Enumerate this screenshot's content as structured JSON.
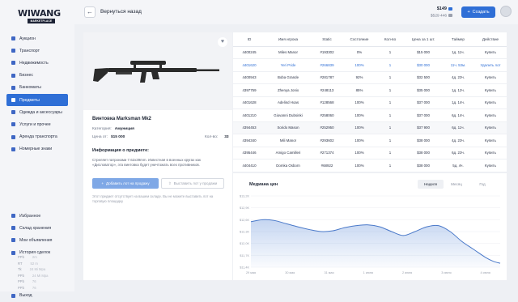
{
  "logo": {
    "main": "WIWANG",
    "sub": "MARKETPLACE"
  },
  "sidebar": {
    "items": [
      {
        "label": "Аукцион",
        "icon": "gavel-icon"
      },
      {
        "label": "Транспорт",
        "icon": "car-icon"
      },
      {
        "label": "Недвижимость",
        "icon": "house-icon"
      },
      {
        "label": "Бизнес",
        "icon": "briefcase-icon"
      },
      {
        "label": "Банкоматы",
        "icon": "atm-icon"
      },
      {
        "label": "Предметы",
        "icon": "box-icon",
        "active": true
      },
      {
        "label": "Одежда и аксессуары",
        "icon": "shirt-icon"
      },
      {
        "label": "Услуги и прочее",
        "icon": "tools-icon"
      },
      {
        "label": "Аренда транспорта",
        "icon": "key-icon"
      },
      {
        "label": "Номерные знаки",
        "icon": "plate-icon"
      }
    ],
    "bottom": [
      {
        "label": "Избранное",
        "icon": "heart-icon"
      },
      {
        "label": "Склад хранения",
        "icon": "warehouse-icon"
      },
      {
        "label": "Мои объявления",
        "icon": "list-icon"
      },
      {
        "label": "История сделок",
        "icon": "history-icon"
      },
      {
        "label": "Выход",
        "icon": "exit-icon"
      }
    ],
    "history": [
      {
        "a": "PPb",
        "b": "2m"
      },
      {
        "a": "RT",
        "b": "52 m"
      },
      {
        "a": "Tk",
        "b": "24 Mi Mpa"
      },
      {
        "a": "PPb",
        "b": "24 Mi Mpa"
      },
      {
        "a": "PPb",
        "b": "76"
      },
      {
        "a": "PPb",
        "b": "76"
      }
    ]
  },
  "topbar": {
    "back_label": "Вернуться назад",
    "balance_main": "$149",
    "balance_sub": "$529 446",
    "create_label": "Создать"
  },
  "item": {
    "title": "Винтовка Marksman Mk2",
    "category_label": "Категория:",
    "category": "Амуниция",
    "price_label": "Цена от:",
    "price": "$15 000",
    "qty_label": "Кол-во:",
    "qty": "33",
    "info_title": "Информация о предмете:",
    "info_text": "Стреляет патронами 7.62x39mm. Известная в военных кругах как «Дисловатор», эта винтовка будет уничтожать всех противников.",
    "btn_add": "Добавить лот на продажу",
    "btn_sell": "Выставить лот у продажи",
    "note": "Этот предмет отсутствует на вашем складе. Вы не можете выставить лот на торговую площадку"
  },
  "table": {
    "headers": [
      "ID",
      "Имя игрока",
      "Static",
      "Состояние",
      "Кол-во",
      "Цена за 1 шт.",
      "Таймер",
      "Действие"
    ],
    "rows": [
      [
        "4400245",
        "Miles Manor",
        "#193302",
        "0%",
        "1",
        "$15 000",
        "1д. 11ч.",
        "Купить"
      ],
      [
        "4401620",
        "Yeri Pride",
        "#266839",
        "100%",
        "1",
        "$30 000",
        "11ч. 53м.",
        "Удалить лот"
      ],
      [
        "4400943",
        "Boba Grande",
        "#281787",
        "92%",
        "1",
        "$32 500",
        "4д. 23ч.",
        "Купить"
      ],
      [
        "4397759",
        "Zhenya Jonix",
        "#248113",
        "85%",
        "1",
        "$35 000",
        "1д. 12ч.",
        "Купить"
      ],
      [
        "4401628",
        "Adelind Hoas",
        "#128568",
        "100%",
        "1",
        "$37 000",
        "1д. 14ч.",
        "Купить"
      ],
      [
        "4401210",
        "Giovanni Dubsinki",
        "#258060",
        "100%",
        "1",
        "$37 000",
        "6д. 14ч.",
        "Купить"
      ],
      [
        "4394453",
        "Sorido Mason",
        "#252950",
        "100%",
        "1",
        "$37 900",
        "6д. 11ч.",
        "Купить"
      ],
      [
        "4394340",
        "Mili Manor",
        "#293602",
        "100%",
        "1",
        "$38 000",
        "4д. 23ч.",
        "Купить"
      ],
      [
        "4395446",
        "Amigo Camilleri",
        "#271374",
        "100%",
        "1",
        "$38 000",
        "6д. 23ч.",
        "Купить"
      ],
      [
        "4404410",
        "Domka Osborn",
        "#68922",
        "100%",
        "1",
        "$38 000",
        "5д. 4ч.",
        "Купить"
      ]
    ]
  },
  "chart": {
    "title": "Медиана цен",
    "tabs": [
      "Неделя",
      "Месяц",
      "Год"
    ],
    "active_tab": "Неделя"
  },
  "chart_data": {
    "type": "area",
    "title": "Медиана цен",
    "x": [
      "29 мая",
      "30 мая",
      "31 мая",
      "1 июня",
      "2 июня",
      "3 июня",
      "4 июня"
    ],
    "y_ticks": [
      "$13,2K",
      "$12,9K",
      "$12,6K",
      "$12,3K",
      "$12,0K",
      "$11,7K",
      "$11,4K"
    ],
    "ylim": [
      11.4,
      13.2
    ],
    "points": [
      [
        0,
        12.55
      ],
      [
        0.3,
        12.6
      ],
      [
        0.6,
        12.58
      ],
      [
        0.9,
        12.5
      ],
      [
        1.2,
        12.42
      ],
      [
        1.5,
        12.35
      ],
      [
        1.8,
        12.3
      ],
      [
        2.1,
        12.32
      ],
      [
        2.4,
        12.4
      ],
      [
        2.7,
        12.45
      ],
      [
        3.0,
        12.47
      ],
      [
        3.3,
        12.42
      ],
      [
        3.6,
        12.3
      ],
      [
        3.9,
        12.2
      ],
      [
        4.2,
        12.3
      ],
      [
        4.5,
        12.42
      ],
      [
        4.8,
        12.45
      ],
      [
        5.1,
        12.3
      ],
      [
        5.4,
        12.05
      ],
      [
        5.7,
        11.85
      ],
      [
        6.0,
        11.65
      ],
      [
        6.2,
        11.55
      ],
      [
        6.38,
        11.5
      ]
    ],
    "grid": true,
    "color": "#4a79c9"
  }
}
